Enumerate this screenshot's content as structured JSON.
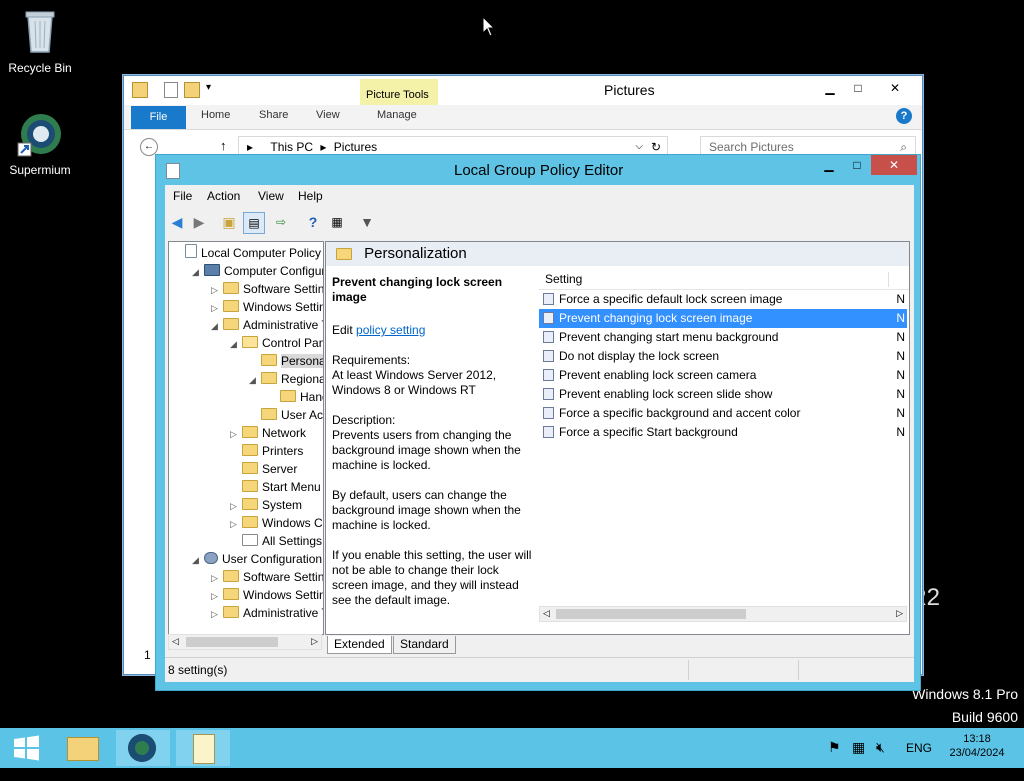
{
  "desktop": {
    "icons": [
      {
        "label": "Recycle Bin"
      },
      {
        "label": "Supermium"
      }
    ],
    "watermark": {
      "line1": "Windows 8.1 Pro",
      "line2": "Build 9600",
      "partial": "R2"
    }
  },
  "explorer": {
    "title": "Pictures",
    "context_tab_group": "Picture Tools",
    "tabs": [
      "File",
      "Home",
      "Share",
      "View",
      "Manage"
    ],
    "address": {
      "segments": [
        "This PC",
        "Pictures"
      ]
    },
    "search": {
      "placeholder": "Search Pictures"
    },
    "left_fragment": "1"
  },
  "gpo": {
    "title": "Local Group Policy Editor",
    "menu": [
      "File",
      "Action",
      "View",
      "Help"
    ],
    "tree": [
      {
        "label": "Local Computer Policy",
        "indent": 0,
        "expander": "",
        "icon": "policy"
      },
      {
        "label": "Computer Configura",
        "indent": 1,
        "expander": "open",
        "icon": "computer"
      },
      {
        "label": "Software Settings",
        "indent": 2,
        "expander": "closed",
        "icon": "folder"
      },
      {
        "label": "Windows Setting",
        "indent": 2,
        "expander": "closed",
        "icon": "folder"
      },
      {
        "label": "Administrative Te",
        "indent": 2,
        "expander": "open",
        "icon": "folder"
      },
      {
        "label": "Control Panel",
        "indent": 3,
        "expander": "open",
        "icon": "folder-open"
      },
      {
        "label": "Personaliz",
        "indent": 4,
        "expander": "",
        "icon": "folder",
        "selected": true
      },
      {
        "label": "Regional a",
        "indent": 4,
        "expander": "open",
        "icon": "folder"
      },
      {
        "label": "Handv",
        "indent": 5,
        "expander": "",
        "icon": "folder"
      },
      {
        "label": "User Acco",
        "indent": 4,
        "expander": "",
        "icon": "folder"
      },
      {
        "label": "Network",
        "indent": 3,
        "expander": "closed",
        "icon": "folder"
      },
      {
        "label": "Printers",
        "indent": 3,
        "expander": "",
        "icon": "folder"
      },
      {
        "label": "Server",
        "indent": 3,
        "expander": "",
        "icon": "folder"
      },
      {
        "label": "Start Menu ar",
        "indent": 3,
        "expander": "",
        "icon": "folder"
      },
      {
        "label": "System",
        "indent": 3,
        "expander": "closed",
        "icon": "folder"
      },
      {
        "label": "Windows Cor",
        "indent": 3,
        "expander": "closed",
        "icon": "folder"
      },
      {
        "label": "All Settings",
        "indent": 3,
        "expander": "",
        "icon": "settings"
      },
      {
        "label": "User Configuration",
        "indent": 1,
        "expander": "open",
        "icon": "user"
      },
      {
        "label": "Software Settings",
        "indent": 2,
        "expander": "closed",
        "icon": "folder"
      },
      {
        "label": "Windows Setting",
        "indent": 2,
        "expander": "closed",
        "icon": "folder"
      },
      {
        "label": "Administrative Te",
        "indent": 2,
        "expander": "closed",
        "icon": "folder"
      }
    ],
    "pane_title": "Personalization",
    "description": {
      "heading": "Prevent changing lock screen image",
      "edit_prefix": "Edit",
      "edit_link": "policy setting",
      "requirements_label": "Requirements:",
      "requirements": "At least Windows Server 2012, Windows 8 or Windows RT",
      "description_label": "Description:",
      "paragraphs": [
        "Prevents users from changing the background image shown when the machine is locked.",
        "By default, users can change the background image shown when the machine is locked.",
        "If you enable this setting, the user will not be able to change their lock screen image, and they will instead see the default image."
      ]
    },
    "list_header": "Setting",
    "settings": [
      {
        "name": "Force a specific default lock screen image",
        "state": "N"
      },
      {
        "name": "Prevent changing lock screen image",
        "state": "N",
        "selected": true
      },
      {
        "name": "Prevent changing start menu background",
        "state": "N"
      },
      {
        "name": "Do not display the lock screen",
        "state": "N"
      },
      {
        "name": "Prevent enabling lock screen camera",
        "state": "N"
      },
      {
        "name": "Prevent enabling lock screen slide show",
        "state": "N"
      },
      {
        "name": "Force a specific background and accent color",
        "state": "N"
      },
      {
        "name": "Force a specific Start background",
        "state": "N"
      }
    ],
    "bottom_tabs": [
      "Extended",
      "Standard"
    ],
    "status": "8 setting(s)"
  },
  "taskbar": {
    "language": "ENG",
    "time": "13:18",
    "date": "23/04/2024"
  },
  "colors": {
    "taskbar": "#5bc3e6",
    "gpo_frame": "#5ec3e4",
    "selection": "#3390ff",
    "link": "#0066cc",
    "close": "#c7504b"
  }
}
